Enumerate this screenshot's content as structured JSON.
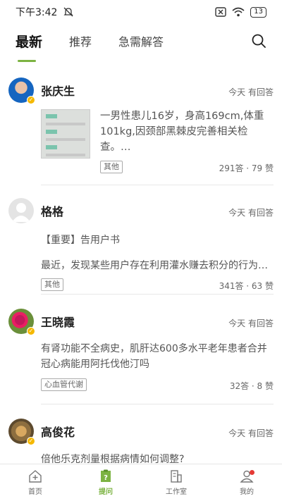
{
  "status": {
    "time": "下午3:42",
    "battery": "13"
  },
  "tabs": [
    {
      "label": "最新"
    },
    {
      "label": "推荐"
    },
    {
      "label": "急需解答"
    }
  ],
  "questions": [
    {
      "user": "张庆生",
      "meta": "今天 有回答",
      "text": "一男性患儿16岁，身高169cm,体重101kg,因颈部黑棘皮完善相关检查。…",
      "tag": "其他",
      "stats": "291答 · 79 赞"
    },
    {
      "user": "格格",
      "meta": "今天 有回答",
      "title": "【重要】告用户书",
      "text": "最近，发现某些用户存在利用灌水赚去积分的行为…",
      "tag": "其他",
      "stats": "341答 · 63 赞"
    },
    {
      "user": "王晓霞",
      "meta": "今天 有回答",
      "text": "有肾功能不全病史，肌肝达600多水平老年患者合并冠心病能用阿托伐他汀吗",
      "tag": "心血管代谢",
      "stats": "32答 · 8 赞"
    },
    {
      "user": "高俊花",
      "meta": "今天 有回答",
      "text": "倍他乐克剂量根据病情如何调整?"
    }
  ],
  "bottom_nav": [
    {
      "label": "首页",
      "icon": "home-plus-icon"
    },
    {
      "label": "提问",
      "icon": "ask-icon"
    },
    {
      "label": "工作室",
      "icon": "studio-icon"
    },
    {
      "label": "我的",
      "icon": "profile-icon"
    }
  ],
  "colors": {
    "accent": "#7cb342",
    "badge": "#f5b800",
    "dot": "#e53935"
  }
}
